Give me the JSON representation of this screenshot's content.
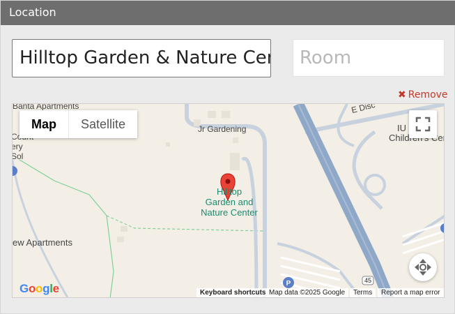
{
  "header": {
    "title": "Location"
  },
  "location_input": {
    "value": "Hilltop Garden & Nature Center"
  },
  "room_input": {
    "placeholder": "Room"
  },
  "remove": {
    "label": "Remove"
  },
  "map": {
    "map_type": {
      "map_label": "Map",
      "satellite_label": "Satellite",
      "selected": "Map"
    },
    "labels": {
      "banta": "Banta Apartments",
      "jr_gardening": "Jr Gardening",
      "iu_label": "IU C",
      "childrens_center": "Children's Center",
      "e_disc": "E Disc",
      "county": "Count",
      "ery": "ery",
      "sol": "Sol",
      "new_apartments": "ew Apartments",
      "poi_line1": "Hilltop",
      "poi_line2": "Garden and",
      "poi_line3": "Nature Center",
      "parking": "P",
      "route_45": "45"
    },
    "footer": {
      "google": "Google",
      "keyboard_shortcuts": "Keyboard shortcuts",
      "map_data": "Map data ©2025 Google",
      "terms": "Terms",
      "report": "Report a map error"
    },
    "icons": {
      "fullscreen": "fullscreen-icon",
      "camera": "camera-control-icon",
      "marker": "map-marker-icon"
    },
    "colors": {
      "marker": "#ea4335",
      "highway": "#8fa8c8",
      "road": "#c8d2de",
      "trail": "#7fcf98",
      "poi_text": "#1a8a6f"
    }
  }
}
